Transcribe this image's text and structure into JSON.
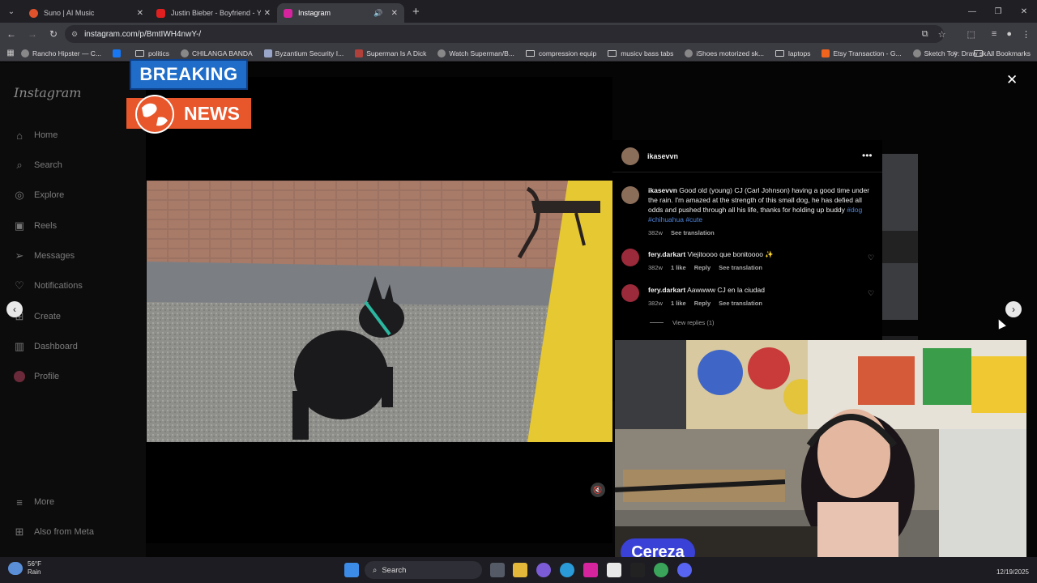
{
  "tabs": [
    {
      "title": "Suno | AI Music",
      "color": "#e0522b"
    },
    {
      "title": "Justin Bieber - Boyfriend - YouT",
      "color": "#e02020"
    },
    {
      "title": "Instagram",
      "color": "#d6249f",
      "active": true
    }
  ],
  "address": {
    "url": "instagram.com/p/BmtIWH4nwY-/"
  },
  "bookmarks": [
    {
      "label": "Rancho Hipster — C..."
    },
    {
      "label": "politics"
    },
    {
      "label": "CHILANGA BANDA"
    },
    {
      "label": "Byzantium Security I..."
    },
    {
      "label": "Superman Is A Dick"
    },
    {
      "label": "Watch Superman/B..."
    },
    {
      "label": "compression equip"
    },
    {
      "label": "musicv bass tabs"
    },
    {
      "label": "iShoes motorized sk..."
    },
    {
      "label": "laptops"
    },
    {
      "label": "Etsy Transaction - G..."
    },
    {
      "label": "Sketch Toy: Draw sk..."
    }
  ],
  "all_bookmarks": "All Bookmarks",
  "sidebar": {
    "logo": "Instagram",
    "items": [
      {
        "label": "Home"
      },
      {
        "label": "Search"
      },
      {
        "label": "Explore"
      },
      {
        "label": "Reels"
      },
      {
        "label": "Messages"
      },
      {
        "label": "Notifications"
      },
      {
        "label": "Create"
      },
      {
        "label": "Dashboard"
      },
      {
        "label": "Profile"
      }
    ],
    "more": "More",
    "meta": "Also from Meta"
  },
  "overlay": {
    "breaking": "BREAKING",
    "news": "NEWS",
    "streamer": "Cereza"
  },
  "post": {
    "author": "ikasevvn",
    "caption_user": "ikasevvn",
    "caption": "Good old (young) CJ (Carl Johnson) having a good time under the rain. I'm amazed at the strength of this small dog, he has defied all odds and pushed through all his life, thanks for holding up buddy",
    "hashtags": "#dog #chihuahua #cute",
    "caption_age": "382w",
    "see_translation": "See translation",
    "comments": [
      {
        "user": "fery.darkart",
        "text": "Viejitoooo que bonitoooo ✨",
        "age": "382w",
        "likes": "1 like",
        "reply": "Reply",
        "translate": "See translation"
      },
      {
        "user": "fery.darkart",
        "text": "Aawwww CJ en la ciudad",
        "age": "382w",
        "likes": "1 like",
        "reply": "Reply",
        "translate": "See translation"
      }
    ],
    "view_replies": "View replies (1)"
  },
  "taskbar": {
    "temp": "56°F",
    "condition": "Rain",
    "search": "Search",
    "date": "12/19/2025"
  }
}
